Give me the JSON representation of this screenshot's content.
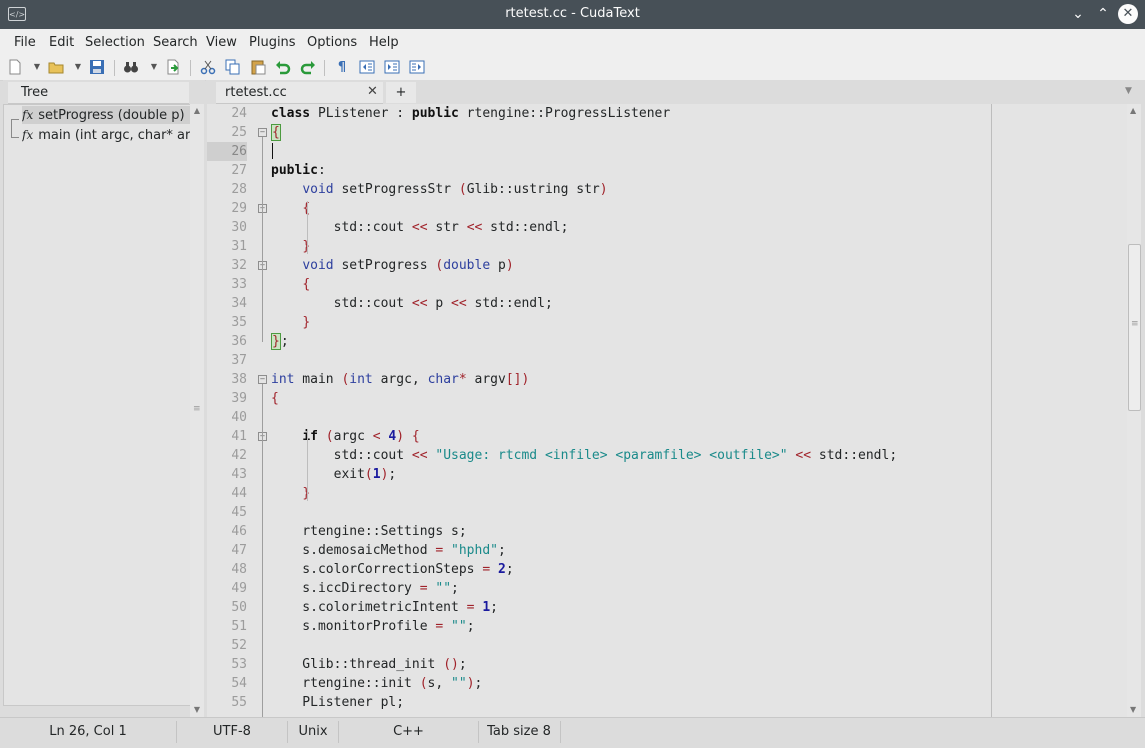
{
  "window": {
    "title": "rtetest.cc - CudaText",
    "app_icon": "</>"
  },
  "menu": [
    "File",
    "Edit",
    "Selection",
    "Search",
    "View",
    "Plugins",
    "Options",
    "Help"
  ],
  "left_panel": {
    "tab": "Tree",
    "items": [
      "setProgress (double p)",
      "main (int argc, char* argv"
    ]
  },
  "tabs": {
    "file": "rtetest.cc",
    "close": "✕",
    "plus": "+"
  },
  "editor": {
    "current_line": 26,
    "lines": [
      {
        "n": "24",
        "html": "<span class=\"kw\">class</span> PListener : <span class=\"kw\">public</span> rtengine::ProgressListener"
      },
      {
        "n": "25",
        "html": "<span class=\"bracehl br\">{</span>"
      },
      {
        "n": "26",
        "html": ""
      },
      {
        "n": "27",
        "html": "<span class=\"kw\">public</span>:"
      },
      {
        "n": "28",
        "html": "    <span class=\"ty\">void</span> setProgressStr <span class=\"br\">(</span>Glib::ustring str<span class=\"br\">)</span>"
      },
      {
        "n": "29",
        "html": "    <span class=\"br\">{</span>"
      },
      {
        "n": "30",
        "html": "        std::cout <span class=\"op\">&lt;&lt;</span> str <span class=\"op\">&lt;&lt;</span> std::endl;"
      },
      {
        "n": "31",
        "html": "    <span class=\"br\">}</span>"
      },
      {
        "n": "32",
        "html": "    <span class=\"ty\">void</span> setProgress <span class=\"br\">(</span><span class=\"ty\">double</span> p<span class=\"br\">)</span>"
      },
      {
        "n": "33",
        "html": "    <span class=\"br\">{</span>"
      },
      {
        "n": "34",
        "html": "        std::cout <span class=\"op\">&lt;&lt;</span> p <span class=\"op\">&lt;&lt;</span> std::endl;"
      },
      {
        "n": "35",
        "html": "    <span class=\"br\">}</span>"
      },
      {
        "n": "36",
        "html": "<span class=\"bracehl br\">}</span>;"
      },
      {
        "n": "37",
        "html": ""
      },
      {
        "n": "38",
        "html": "<span class=\"ty\">int</span> main <span class=\"br\">(</span><span class=\"ty\">int</span> argc, <span class=\"ty\">char</span><span class=\"op\">*</span> argv<span class=\"br\">[]</span><span class=\"br\">)</span>"
      },
      {
        "n": "39",
        "html": "<span class=\"br\">{</span>"
      },
      {
        "n": "40",
        "html": ""
      },
      {
        "n": "41",
        "html": "    <span class=\"kw\">if</span> <span class=\"br\">(</span>argc <span class=\"op\">&lt;</span> <span class=\"num\">4</span><span class=\"br\">)</span> <span class=\"br\">{</span>"
      },
      {
        "n": "42",
        "html": "        std::cout <span class=\"op\">&lt;&lt;</span> <span class=\"str\">\"Usage: rtcmd &lt;infile&gt; &lt;paramfile&gt; &lt;outfile&gt;\"</span> <span class=\"op\">&lt;&lt;</span> std::endl;"
      },
      {
        "n": "43",
        "html": "        exit<span class=\"br\">(</span><span class=\"num\">1</span><span class=\"br\">)</span>;"
      },
      {
        "n": "44",
        "html": "    <span class=\"br\">}</span>"
      },
      {
        "n": "45",
        "html": ""
      },
      {
        "n": "46",
        "html": "    rtengine::Settings s;"
      },
      {
        "n": "47",
        "html": "    s.demosaicMethod <span class=\"op\">=</span> <span class=\"str\">\"hphd\"</span>;"
      },
      {
        "n": "48",
        "html": "    s.colorCorrectionSteps <span class=\"op\">=</span> <span class=\"num\">2</span>;"
      },
      {
        "n": "49",
        "html": "    s.iccDirectory <span class=\"op\">=</span> <span class=\"str\">\"\"</span>;"
      },
      {
        "n": "50",
        "html": "    s.colorimetricIntent <span class=\"op\">=</span> <span class=\"num\">1</span>;"
      },
      {
        "n": "51",
        "html": "    s.monitorProfile <span class=\"op\">=</span> <span class=\"str\">\"\"</span>;"
      },
      {
        "n": "52",
        "html": ""
      },
      {
        "n": "53",
        "html": "    Glib::thread_init <span class=\"br\">(</span><span class=\"br\">)</span>;"
      },
      {
        "n": "54",
        "html": "    rtengine::init <span class=\"br\">(</span>s, <span class=\"str\">\"\"</span><span class=\"br\">)</span>;"
      },
      {
        "n": "55",
        "html": "    PListener pl;"
      }
    ]
  },
  "status": {
    "position": "Ln 26, Col 1",
    "encoding": "UTF-8",
    "line_ends": "Unix",
    "lexer": "C++",
    "tab_size": "Tab size 8"
  },
  "colors": {
    "titlebar": "#475057",
    "keyword_type": "#2d3f9e",
    "bracket": "#a0222a",
    "string": "#1a8a8a",
    "number": "#1a1a9e"
  }
}
